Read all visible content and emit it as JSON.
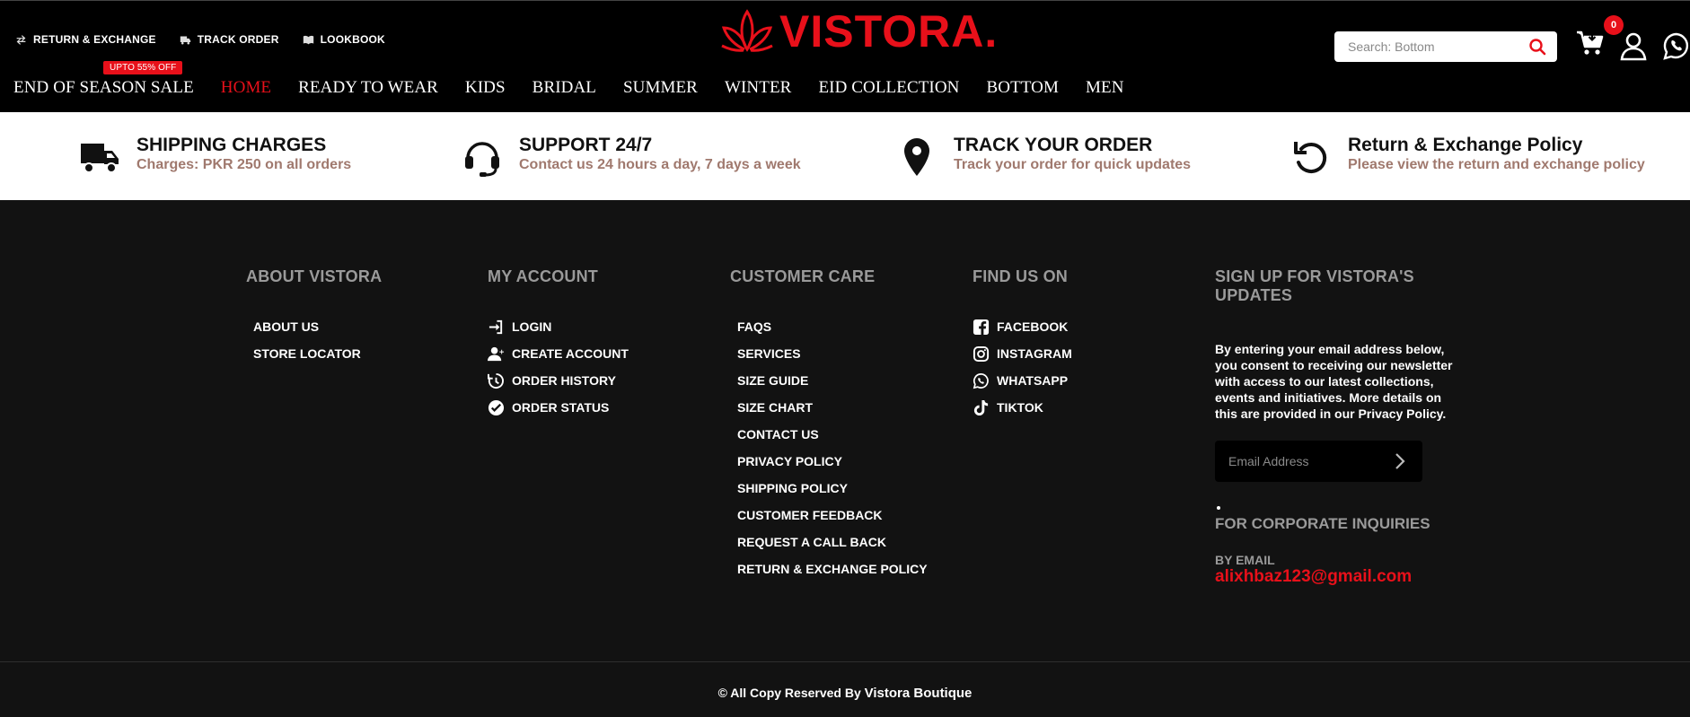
{
  "header": {
    "utility_links": [
      {
        "label": "RETURN & EXCHANGE",
        "icon": "exchange-icon"
      },
      {
        "label": "TRACK ORDER",
        "icon": "truck-icon"
      },
      {
        "label": "LOOKBOOK",
        "icon": "book-icon"
      }
    ],
    "logo_text": "VISTORA.",
    "search_placeholder": "Search: Bottom",
    "cart_count": "0",
    "nav": [
      {
        "label": "END OF SEASON SALE",
        "badge": "UPTO 55% OFF"
      },
      {
        "label": "HOME",
        "active": true
      },
      {
        "label": "READY TO WEAR"
      },
      {
        "label": "KIDS"
      },
      {
        "label": "BRIDAL"
      },
      {
        "label": "SUMMER"
      },
      {
        "label": "WINTER"
      },
      {
        "label": "EID COLLECTION"
      },
      {
        "label": "BOTTOM"
      },
      {
        "label": "MEN"
      }
    ]
  },
  "features": [
    {
      "title": "SHIPPING CHARGES",
      "subtitle": "Charges: PKR 250 on all orders",
      "icon": "truck-icon"
    },
    {
      "title": "SUPPORT 24/7",
      "subtitle": "Contact us 24 hours a day, 7 days a week",
      "icon": "headset-icon"
    },
    {
      "title": "TRACK YOUR ORDER",
      "subtitle": "Track your order for quick updates",
      "icon": "location-pin-icon"
    },
    {
      "title": "Return & Exchange Policy",
      "subtitle": "Please view the return and exchange policy",
      "icon": "return-arrow-icon"
    }
  ],
  "footer": {
    "about": {
      "heading": "ABOUT VISTORA",
      "links": [
        "ABOUT US",
        "STORE LOCATOR"
      ]
    },
    "account": {
      "heading": "MY ACCOUNT",
      "links": [
        {
          "label": "LOGIN",
          "icon": "login-icon"
        },
        {
          "label": "CREATE ACCOUNT",
          "icon": "add-user-icon"
        },
        {
          "label": "ORDER HISTORY",
          "icon": "history-icon"
        },
        {
          "label": "ORDER STATUS",
          "icon": "check-circle-icon"
        }
      ]
    },
    "care": {
      "heading": "CUSTOMER CARE",
      "links": [
        "FAQS",
        "SERVICES",
        "SIZE GUIDE",
        "SIZE CHART",
        "CONTACT US",
        "PRIVACY POLICY",
        "SHIPPING POLICY",
        "CUSTOMER FEEDBACK",
        "REQUEST A CALL BACK",
        "RETURN & EXCHANGE POLICY"
      ]
    },
    "find": {
      "heading": "FIND US ON",
      "links": [
        {
          "label": "FACEBOOK",
          "icon": "facebook-icon"
        },
        {
          "label": "INSTAGRAM",
          "icon": "instagram-icon"
        },
        {
          "label": "WHATSAPP",
          "icon": "whatsapp-icon"
        },
        {
          "label": "TIKTOK",
          "icon": "tiktok-icon"
        }
      ]
    },
    "signup": {
      "heading": "SIGN UP FOR VISTORA'S UPDATES",
      "text": "By entering your email address below, you consent to receiving our newsletter with access to our latest collections, events and initiatives. More details on this are provided in our Privacy Policy.",
      "email_placeholder": "Email Address",
      "corporate_heading": "FOR CORPORATE INQUIRIES",
      "by_email_label": "BY EMAIL",
      "corporate_email": "alixhbaz123@gmail.com"
    },
    "copyright_prefix": "© All Copy Reserved By",
    "copyright_brand": "Vistora Boutique"
  },
  "colors": {
    "accent": "#e8101a",
    "header_bg": "#000000",
    "footer_bg": "#121212",
    "feature_sub": "#a0796e"
  }
}
